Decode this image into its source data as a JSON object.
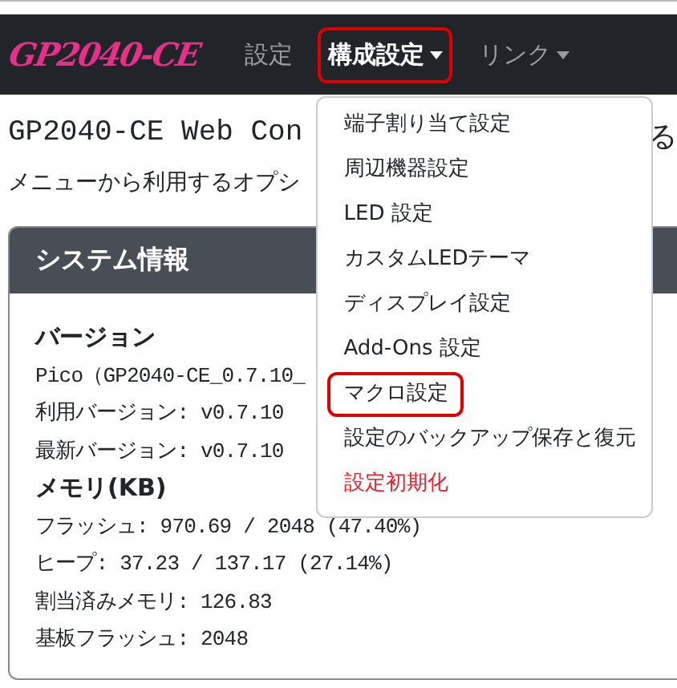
{
  "navbar": {
    "logo": "GP2040-CE",
    "items": [
      {
        "label": "設定",
        "dropdown": false,
        "selected": false,
        "highlighted": false
      },
      {
        "label": "構成設定",
        "dropdown": true,
        "selected": true,
        "highlighted": true
      },
      {
        "label": "リンク",
        "dropdown": true,
        "selected": false,
        "highlighted": false
      }
    ]
  },
  "dropdown_menu": {
    "items": [
      {
        "label": "端子割り当て設定",
        "kind": "normal",
        "highlighted": false
      },
      {
        "label": "周辺機器設定",
        "kind": "normal",
        "highlighted": false
      },
      {
        "label": "LED 設定",
        "kind": "normal",
        "highlighted": false
      },
      {
        "label": "カスタムLEDテーマ",
        "kind": "normal",
        "highlighted": false
      },
      {
        "label": "ディスプレイ設定",
        "kind": "normal",
        "highlighted": false
      },
      {
        "label": "Add-Ons 設定",
        "kind": "normal",
        "highlighted": false
      },
      {
        "label": "マクロ設定",
        "kind": "normal",
        "highlighted": true
      },
      {
        "label": "設定のバックアップ保存と復元",
        "kind": "normal",
        "highlighted": false
      },
      {
        "label": "設定初期化",
        "kind": "danger",
        "highlighted": false
      }
    ]
  },
  "heading": {
    "left": "GP2040-CE Web Con",
    "right": "る"
  },
  "subtitle": "メニューから利用するオプシ",
  "card": {
    "title": "システム情報",
    "lines": [
      {
        "text": "バージョン",
        "kind": "heading"
      },
      {
        "text": "Pico（GP2040-CE_0.7.10_",
        "kind": "text"
      },
      {
        "text": "利用バージョン: v0.7.10",
        "kind": "text"
      },
      {
        "text": "最新バージョン: v0.7.10",
        "kind": "text"
      },
      {
        "text": "メモリ(KB)",
        "kind": "heading"
      },
      {
        "text": "フラッシュ: 970.69 / 2048 (47.40%)",
        "kind": "text"
      },
      {
        "text": "ヒープ: 37.23 / 137.17 (27.14%)",
        "kind": "text"
      },
      {
        "text": "割当済みメモリ: 126.83",
        "kind": "text"
      },
      {
        "text": "基板フラッシュ: 2048",
        "kind": "text"
      }
    ]
  }
}
